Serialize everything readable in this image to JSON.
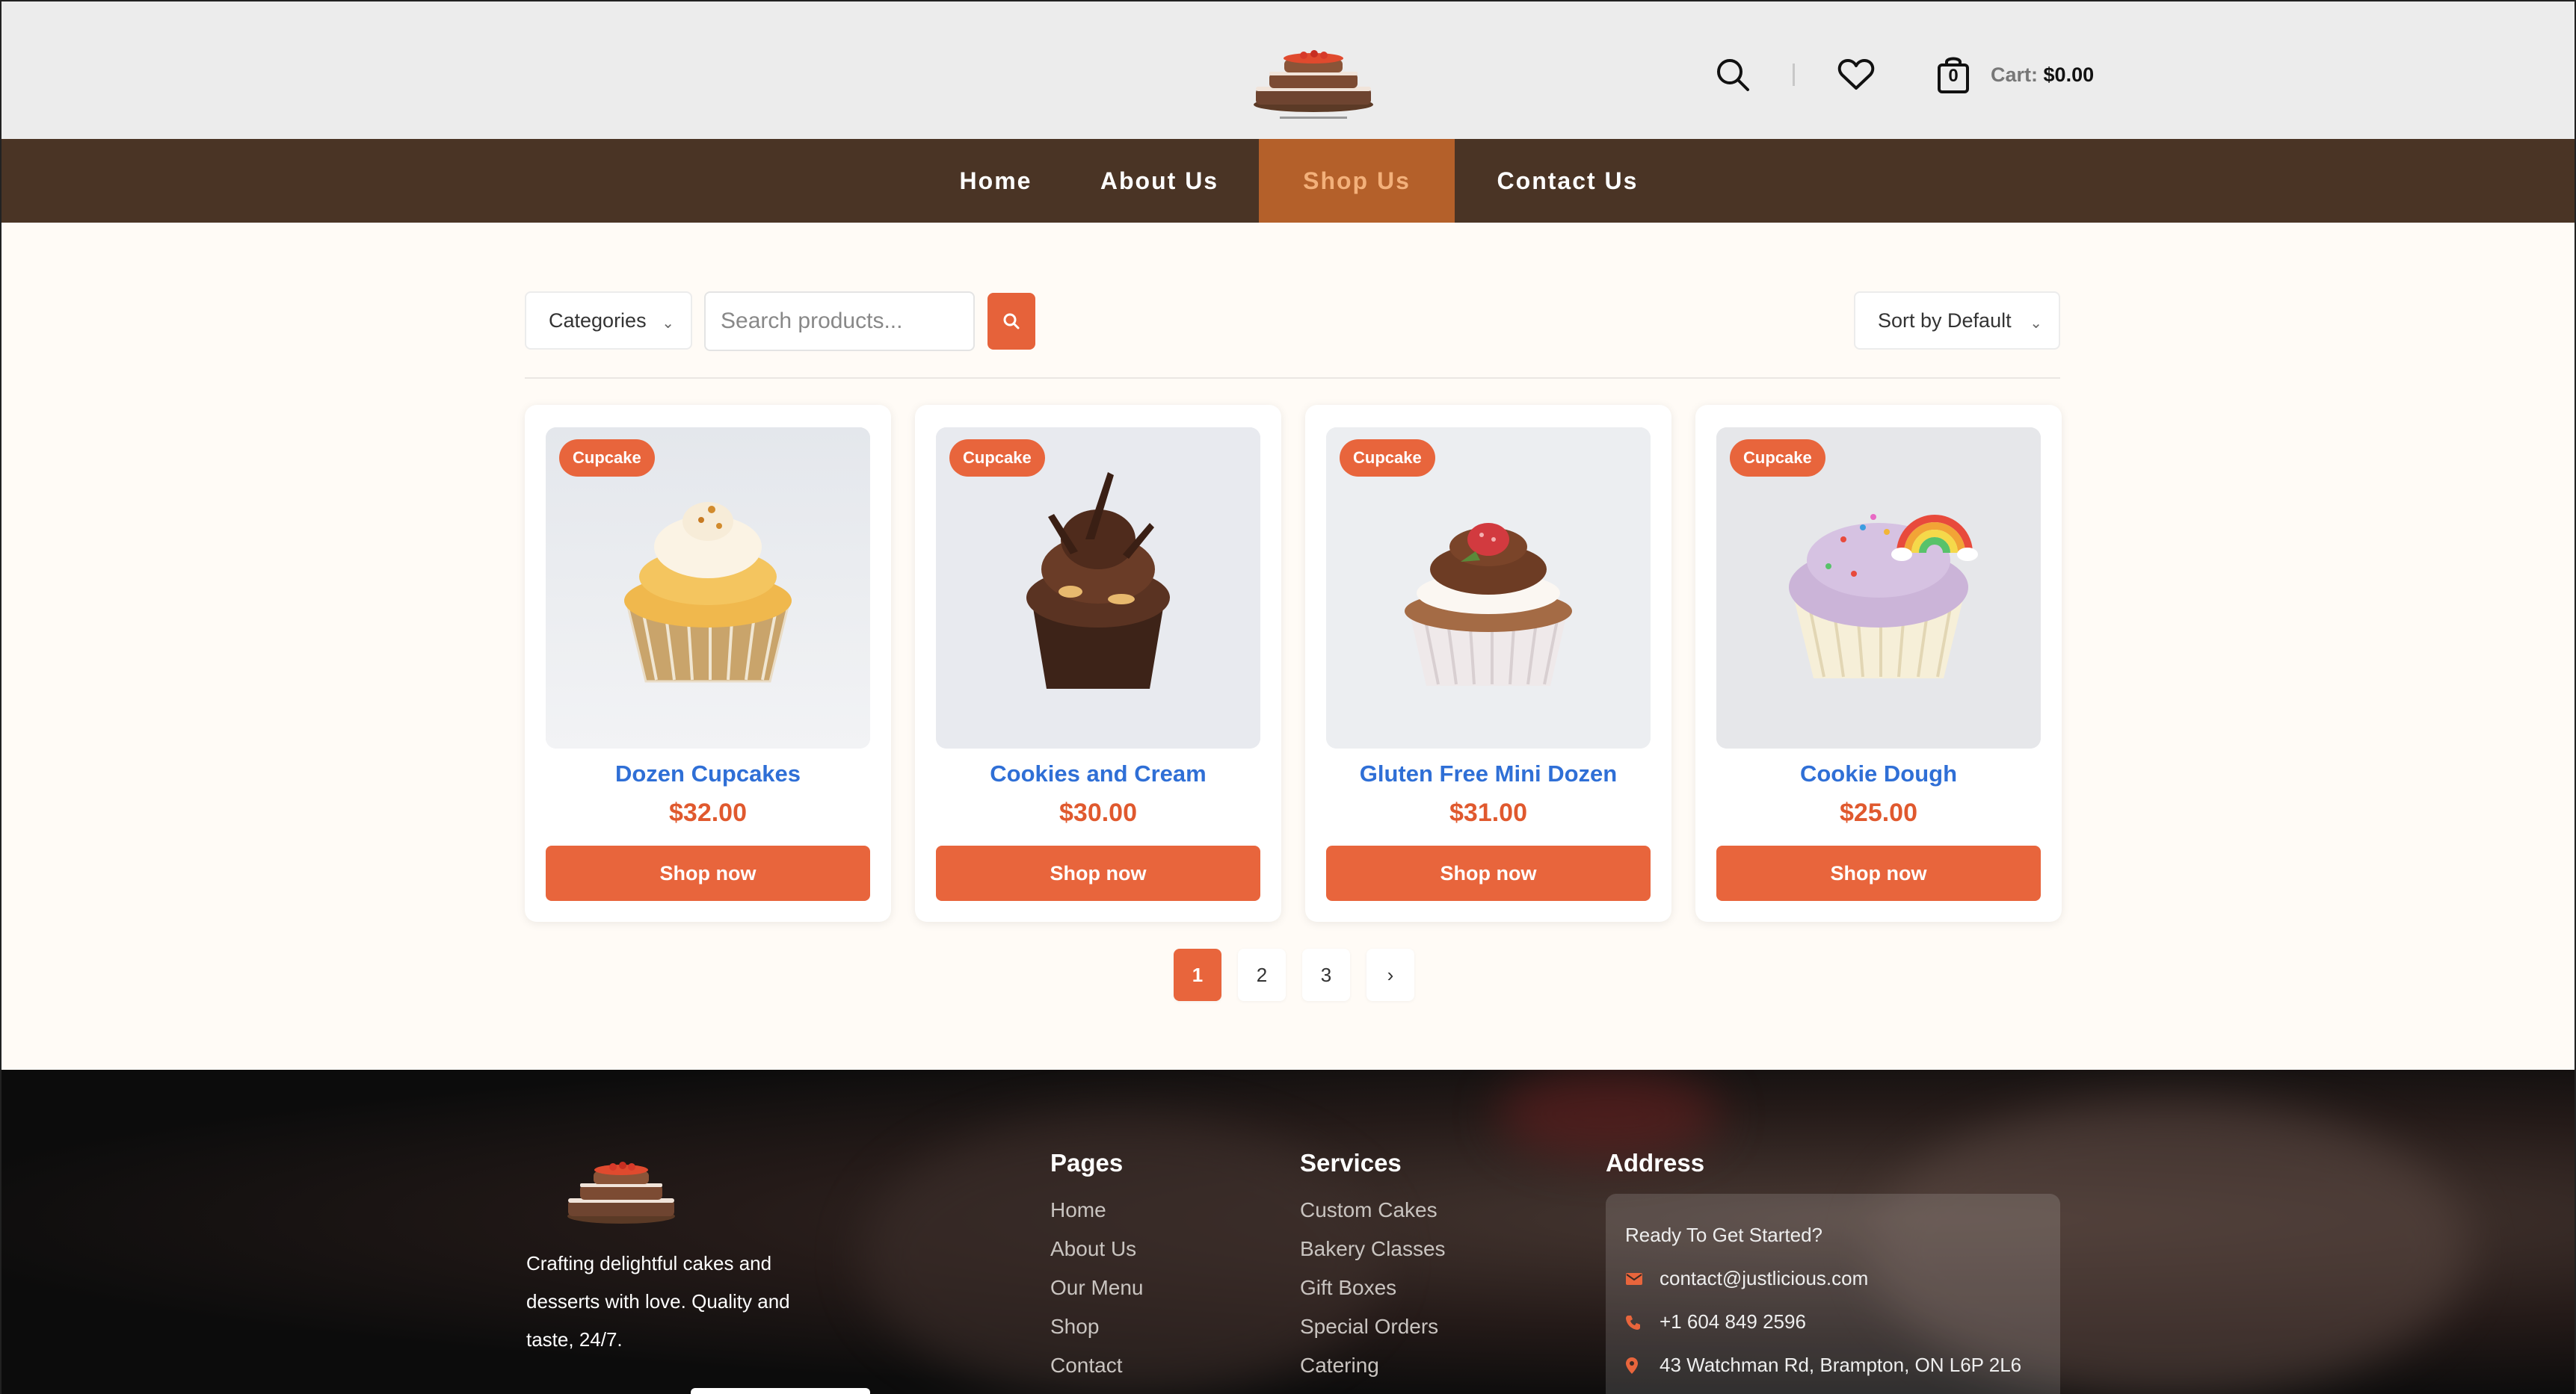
{
  "header": {
    "cart_label": "Cart:",
    "cart_total": "$0.00",
    "cart_count": "0",
    "icons": [
      "search-icon",
      "heart-icon",
      "shopping-bag-icon"
    ]
  },
  "nav": [
    {
      "label": "Home",
      "active": false
    },
    {
      "label": "About Us",
      "active": false
    },
    {
      "label": "Shop Us",
      "active": true
    },
    {
      "label": "Contact Us",
      "active": false
    }
  ],
  "toolbar": {
    "categories_label": "Categories",
    "search_placeholder": "Search products...",
    "sort_label": "Sort by Default"
  },
  "products": [
    {
      "badge": "Cupcake",
      "title": "Dozen Cupcakes",
      "price": "$32.00",
      "button": "Shop now"
    },
    {
      "badge": "Cupcake",
      "title": "Cookies and Cream",
      "price": "$30.00",
      "button": "Shop now"
    },
    {
      "badge": "Cupcake",
      "title": "Gluten Free Mini Dozen",
      "price": "$31.00",
      "button": "Shop now"
    },
    {
      "badge": "Cupcake",
      "title": "Cookie Dough",
      "price": "$25.00",
      "button": "Shop now"
    }
  ],
  "pagination": {
    "pages": [
      "1",
      "2",
      "3"
    ],
    "current": "1",
    "next": "›"
  },
  "footer": {
    "about": "Crafting delightful cakes and desserts with love. Quality and taste, 24/7.",
    "pages": {
      "title": "Pages",
      "links": [
        "Home",
        "About Us",
        "Our Menu",
        "Shop",
        "Contact"
      ]
    },
    "services": {
      "title": "Services",
      "links": [
        "Custom Cakes",
        "Bakery Classes",
        "Gift Boxes",
        "Special Orders",
        "Catering"
      ]
    },
    "address": {
      "title": "Address",
      "intro": "Ready To Get Started?",
      "email": "contact@justlicious.com",
      "phone": "+1 604 849 2596",
      "location": "43 Watchman Rd, Brampton, ON L6P 2L6"
    }
  },
  "colors": {
    "accent": "#e8653c",
    "nav_bg": "#4a3425",
    "link_blue": "#2f6fd6"
  }
}
